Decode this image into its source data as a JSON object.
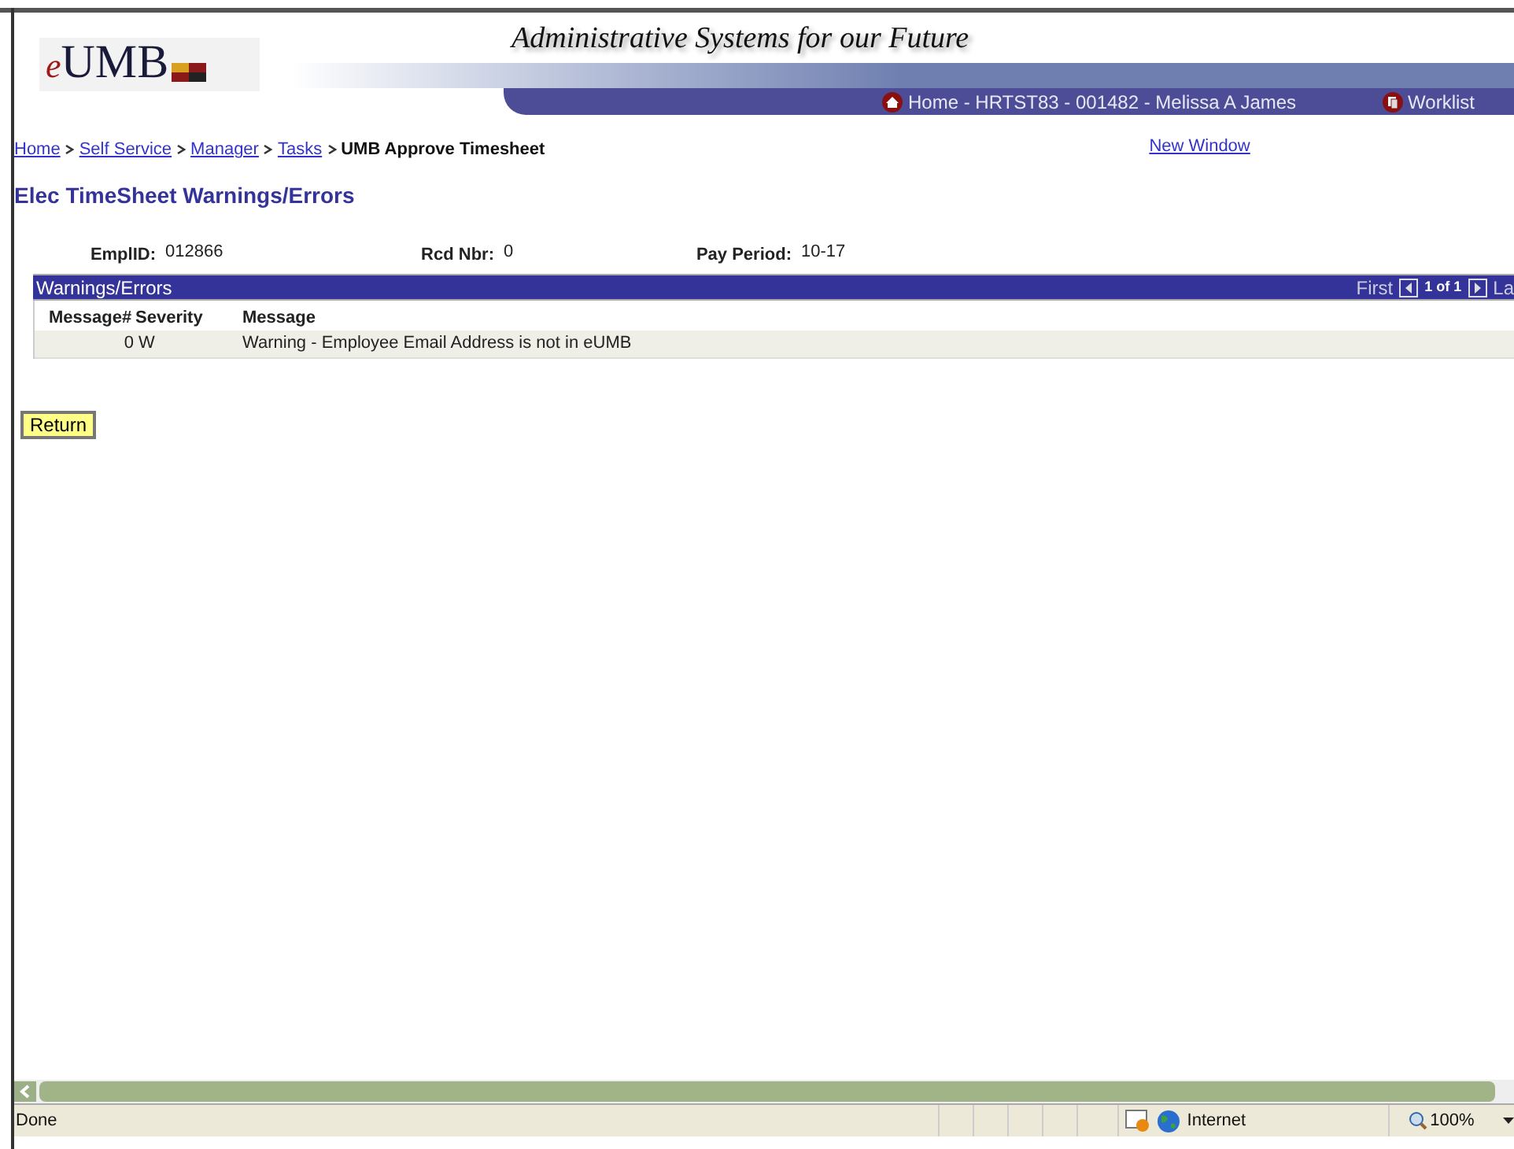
{
  "header": {
    "logo": "eUMB",
    "tagline": "Administrative Systems for our Future",
    "nav": [
      {
        "kind": "home",
        "label": "Home - HRTST83 - 001482 - Melissa A James"
      },
      {
        "kind": "worklist",
        "label": "Worklist"
      }
    ]
  },
  "breadcrumb": [
    {
      "label": "Home",
      "link": true
    },
    {
      "label": "Self Service",
      "link": true
    },
    {
      "label": "Manager",
      "link": true
    },
    {
      "label": "Tasks",
      "link": true
    },
    {
      "label": "UMB Approve Timesheet",
      "link": false
    }
  ],
  "new_window": "New Window",
  "page_title": "Elec TimeSheet Warnings/Errors",
  "fields": [
    {
      "label": "EmplID:",
      "value": "012866"
    },
    {
      "label": "Rcd Nbr:",
      "value": "0"
    },
    {
      "label": "Pay Period:",
      "value": "10-17"
    }
  ],
  "grid": {
    "title": "Warnings/Errors",
    "first": "First",
    "count": "1 of 1",
    "last": "La",
    "columns": [
      "Message#",
      "Severity",
      "Message"
    ],
    "rows": [
      [
        "0",
        "W",
        "Warning - Employee Email Address is not in eUMB"
      ]
    ]
  },
  "return_button": "Return",
  "status_bar": {
    "text": "Done",
    "zone": "Internet",
    "zoom": "100%"
  }
}
